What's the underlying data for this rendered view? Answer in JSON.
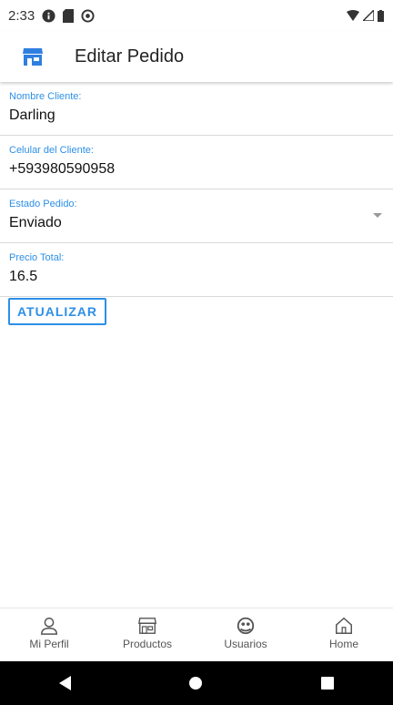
{
  "status_bar": {
    "time": "2:33"
  },
  "app_bar": {
    "title": "Editar Pedido"
  },
  "form": {
    "fields": [
      {
        "label": "Nombre Cliente:",
        "value": "Darling"
      },
      {
        "label": "Celular del Cliente:",
        "value": "+593980590958"
      },
      {
        "label": "Estado Pedido:",
        "value": "Enviado"
      },
      {
        "label": "Precio Total:",
        "value": "16.5"
      }
    ],
    "submit_label": "ATUALIZAR"
  },
  "bottom_nav": {
    "items": [
      {
        "label": "Mi Perfil",
        "icon": "person-icon"
      },
      {
        "label": "Productos",
        "icon": "store-icon"
      },
      {
        "label": "Usuarios",
        "icon": "users-icon"
      },
      {
        "label": "Home",
        "icon": "home-icon"
      }
    ]
  },
  "colors": {
    "accent": "#2d8fe6",
    "app_icon": "#2f7fe0"
  }
}
